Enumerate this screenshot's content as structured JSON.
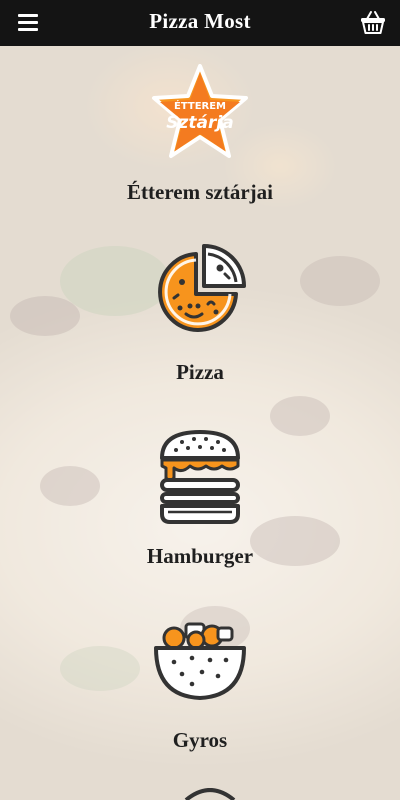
{
  "header": {
    "menu_icon": "hamburger-menu-icon",
    "title": "Pizza Most",
    "basket_icon": "shopping-basket-icon"
  },
  "categories": [
    {
      "label": "Étterem sztárjai",
      "icon": "star-badge-icon",
      "badge_line1": "ÉTTEREM",
      "badge_line2": "Sztárja"
    },
    {
      "label": "Pizza",
      "icon": "pizza-icon"
    },
    {
      "label": "Hamburger",
      "icon": "hamburger-icon"
    },
    {
      "label": "Gyros",
      "icon": "gyros-bowl-icon"
    }
  ],
  "colors": {
    "header_bg": "#141414",
    "accent_orange": "#f7941d",
    "icon_stroke": "#3a3a3a"
  }
}
